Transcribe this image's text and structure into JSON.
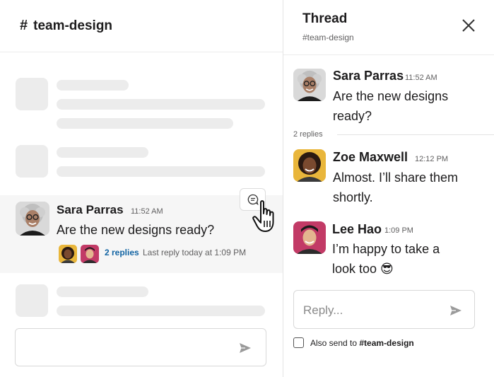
{
  "channel": {
    "hash": "#",
    "name": "team-design"
  },
  "message": {
    "author": "Sara Parras",
    "time": "11:52 AM",
    "text": "Are the new designs ready?",
    "replies_link": "2 replies",
    "last_reply": "Last reply today at 1:09 PM"
  },
  "thread": {
    "title": "Thread",
    "channel": "#team-design",
    "reply_count": "2 replies",
    "messages": [
      {
        "author": "Sara Parras",
        "time": "11:52 AM",
        "text": "Are the new designs ready?"
      },
      {
        "author": "Zoe Maxwell",
        "time": "12:12 PM",
        "text": "Almost. I’ll share them shortly."
      },
      {
        "author": "Lee Hao",
        "time": "1:09 PM",
        "text": "I’m happy to take a look too 😎"
      }
    ],
    "reply_placeholder": "Reply...",
    "also_send_prefix": "Also send to ",
    "also_send_channel": "#team-design"
  },
  "icons": {
    "reply_in_thread": "comment-bubble-icon",
    "send": "send-arrow-icon",
    "close": "close-x-icon",
    "cursor": "hand-pointer-icon"
  },
  "colors": {
    "link": "#1264a3",
    "highlight_bg": "#f6f6f6",
    "skeleton": "#ececec"
  }
}
